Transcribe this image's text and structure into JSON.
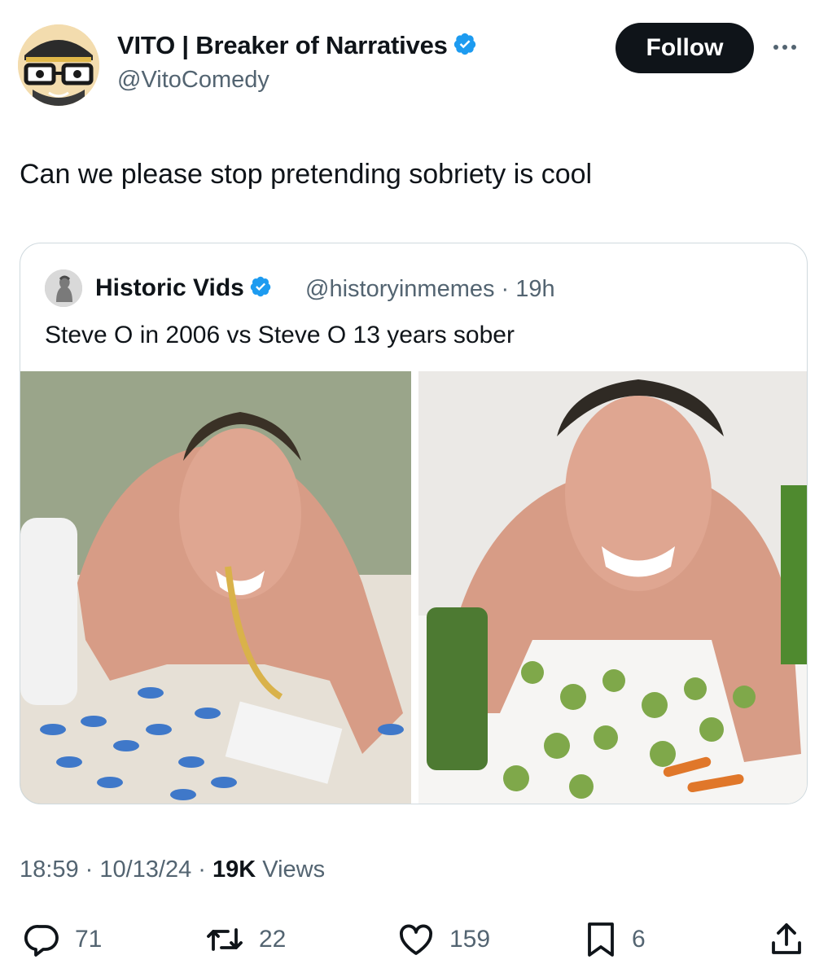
{
  "author": {
    "display_name": "VITO | Breaker of Narratives",
    "handle": "@VitoComedy"
  },
  "follow_label": "Follow",
  "tweet_text": "Can we please stop pretending sobriety is cool",
  "quoted": {
    "display_name": "Historic Vids",
    "handle_time": "@historyinmemes · 19h",
    "text": "Steve O in 2006 vs Steve O 13 years sober"
  },
  "meta": {
    "time": "18:59",
    "date": "10/13/24",
    "views_count": "19K",
    "views_label": "Views"
  },
  "actions": {
    "replies": "71",
    "reposts": "22",
    "likes": "159",
    "bookmarks": "6"
  },
  "colors": {
    "verified": "#1d9bf0",
    "text_primary": "#0f1419",
    "text_secondary": "#536471"
  }
}
